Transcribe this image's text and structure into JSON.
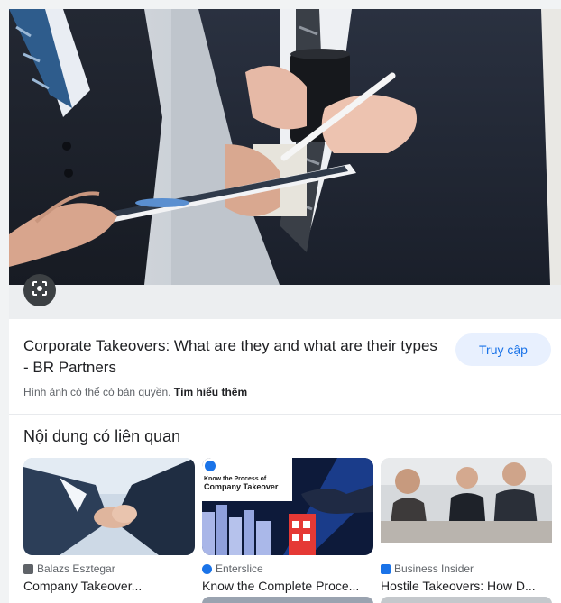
{
  "main_image": {
    "description_icon": "google-lens-icon"
  },
  "info": {
    "title": "Corporate Takeovers: What are they and what are their types - BR Partners",
    "visit_label": "Truy cập",
    "copyright_text": "Hình ảnh có thể có bản quyền.",
    "learn_more": "Tìm hiểu thêm"
  },
  "related": {
    "heading": "Nội dung có liên quan",
    "cards": [
      {
        "source": "Balazs Esztegar",
        "title": "Company Takeover...",
        "favicon_color": "#5f6368"
      },
      {
        "source": "Enterslice",
        "title": "Know the Complete Proce...",
        "favicon_color": "#1a73e8",
        "thumb_text_1": "Know the Process of",
        "thumb_text_2": "Company Takeover"
      },
      {
        "source": "Business Insider",
        "title": "Hostile Takeovers: How D...",
        "favicon_color": "#1a73e8"
      }
    ]
  }
}
